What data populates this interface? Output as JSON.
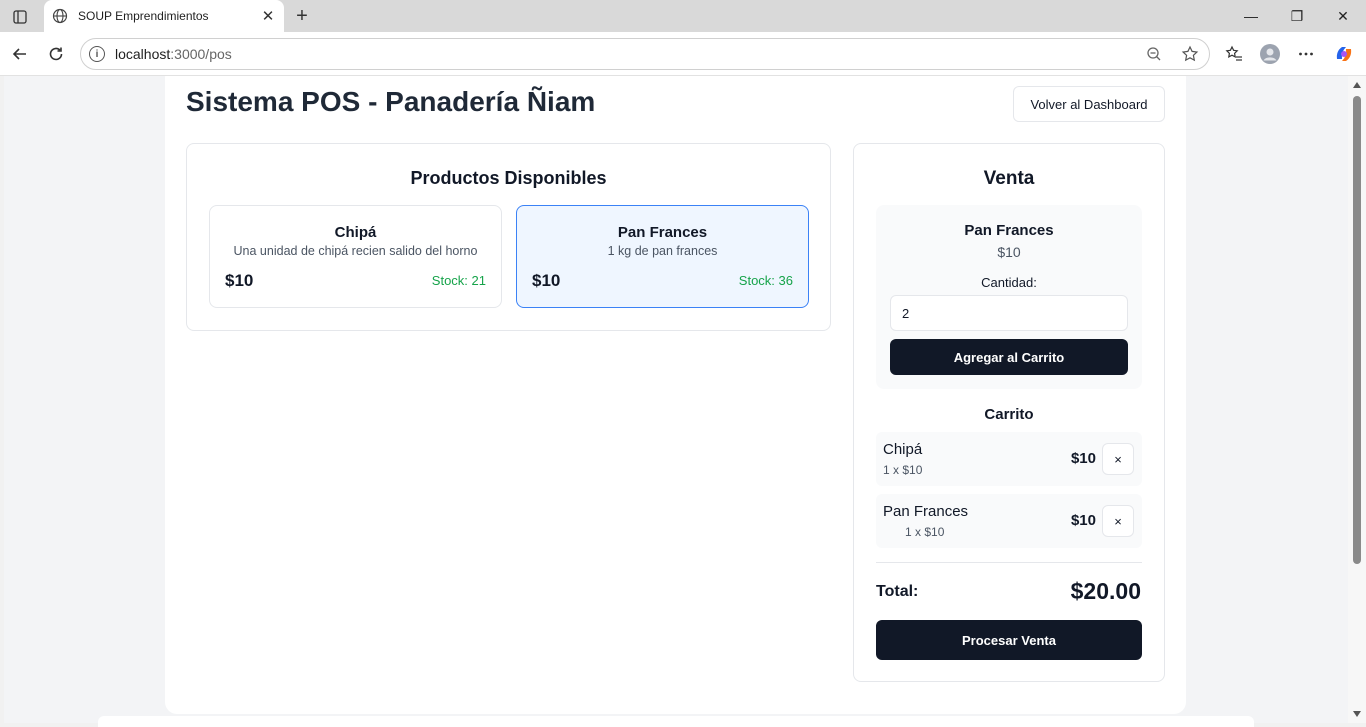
{
  "browser": {
    "tab_title": "SOUP Emprendimientos",
    "url_host": "localhost",
    "url_rest": ":3000/pos"
  },
  "page": {
    "title": "Sistema POS - Panadería Ñiam",
    "dashboard_button": "Volver al Dashboard"
  },
  "products": {
    "heading": "Productos Disponibles",
    "items": [
      {
        "name": "Chipá",
        "description": "Una unidad de chipá recien salido del horno",
        "price": "$10",
        "stock": "Stock: 21",
        "selected": false
      },
      {
        "name": "Pan Frances",
        "description": "1 kg de pan frances",
        "price": "$10",
        "stock": "Stock: 36",
        "selected": true
      }
    ]
  },
  "sale": {
    "heading": "Venta",
    "selected_product": {
      "name": "Pan Frances",
      "price": "$10",
      "quantity_label": "Cantidad:",
      "quantity_value": "2",
      "add_button": "Agregar al Carrito"
    },
    "cart": {
      "title": "Carrito",
      "items": [
        {
          "name": "Chipá",
          "detail": "1 x $10",
          "price": "$10",
          "remove": "×"
        },
        {
          "name": "Pan Frances",
          "detail": "1 x $10",
          "price": "$10",
          "remove": "×"
        }
      ]
    },
    "total_label": "Total:",
    "total_value": "$20.00",
    "process_button": "Procesar Venta"
  },
  "colors": {
    "primary_button": "#111827",
    "selected_card_bg": "#eff6ff",
    "selected_card_border": "#3b82f6",
    "stock_green": "#16a34a"
  }
}
